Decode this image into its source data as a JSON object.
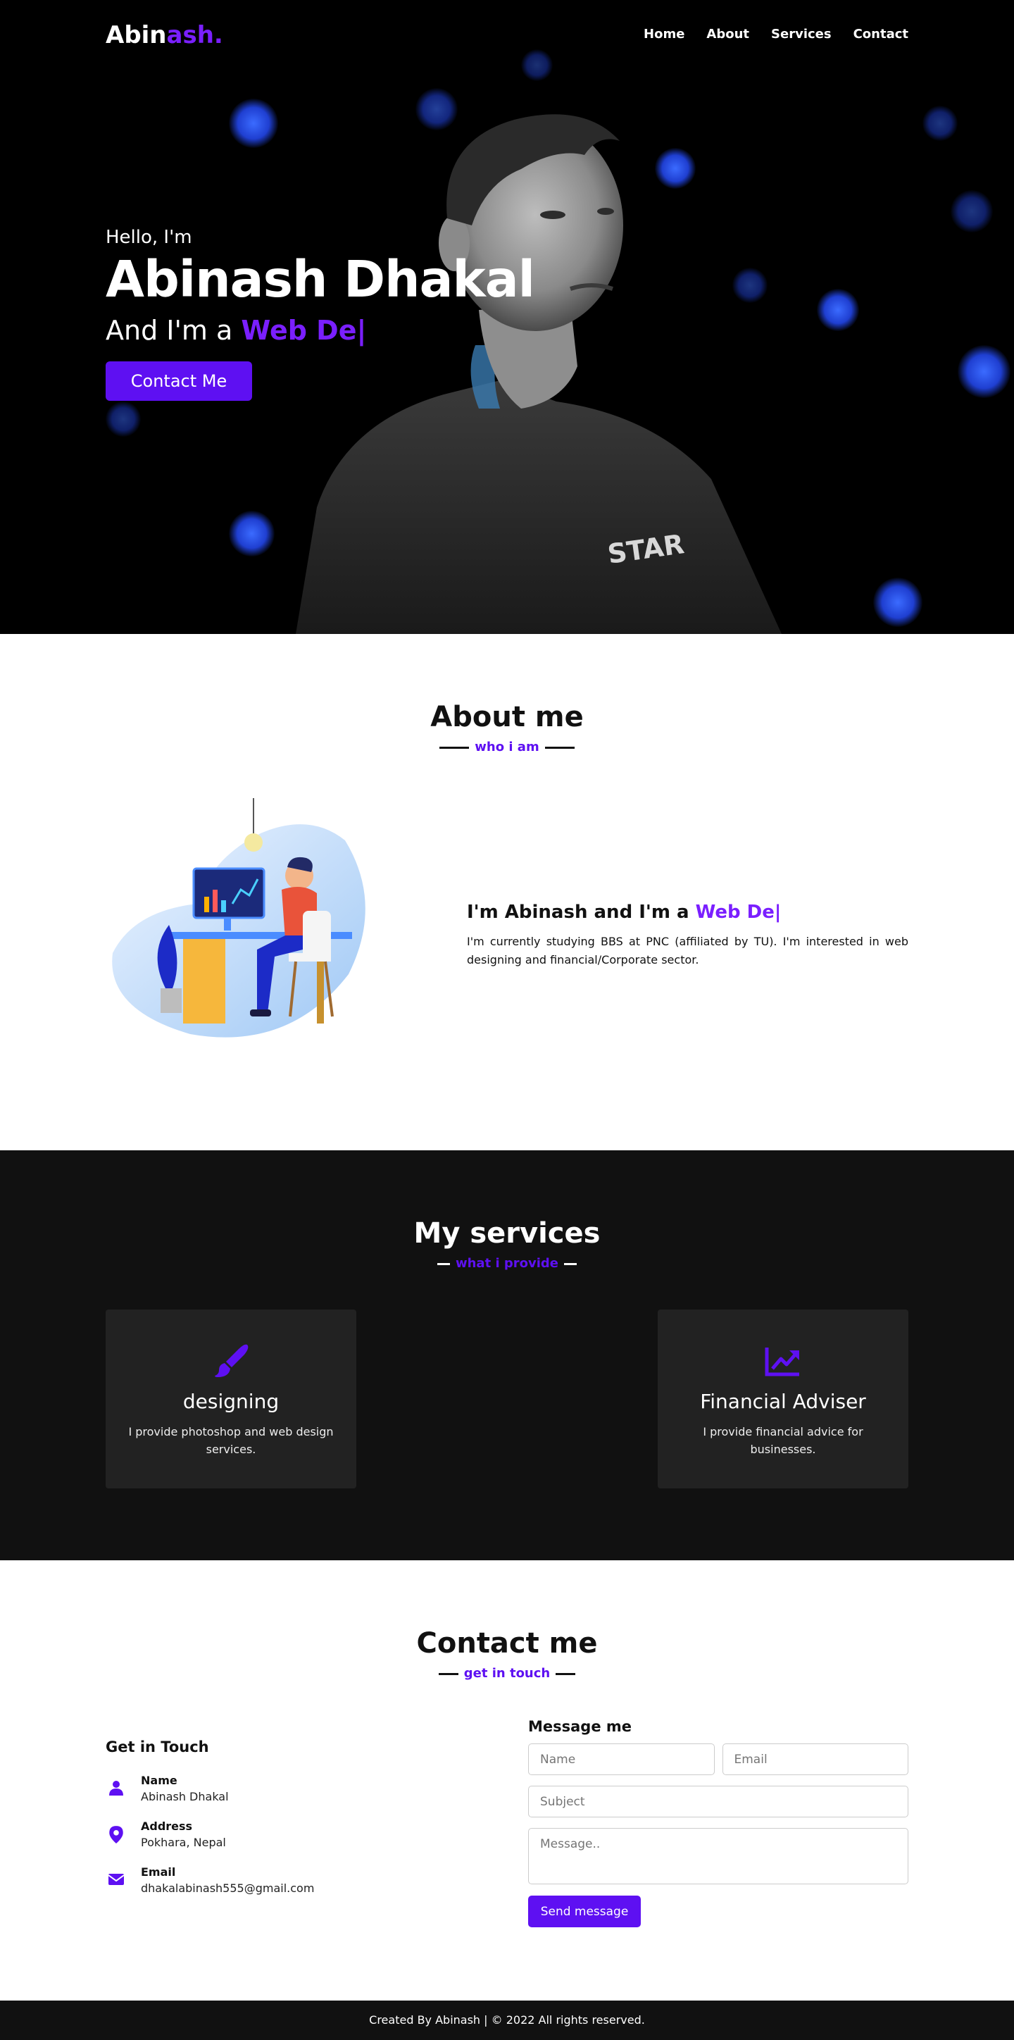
{
  "nav": {
    "logo_main": "Abin",
    "logo_accent": "ash.",
    "items": [
      "Home",
      "About",
      "Services",
      "Contact"
    ]
  },
  "hero": {
    "greeting": "Hello, I'm",
    "name": "Abinash Dhakal",
    "role_prefix": "And I'm a",
    "role_typed": "Web De|",
    "button": "Contact Me"
  },
  "about": {
    "title": "About me",
    "subtitle": "who i am",
    "heading_prefix": "I'm Abinash and I'm a",
    "heading_typed": "Web De|",
    "description": "I'm currently studying BBS at PNC (affiliated by TU). I'm interested in web designing and financial/Corporate sector."
  },
  "services": {
    "title": "My services",
    "subtitle": "what i provide",
    "cards": [
      {
        "icon": "paintbrush-icon",
        "title": "designing",
        "description": "I provide photoshop and web design services."
      },
      {
        "icon": "chart-line-icon",
        "title": "Financial Adviser",
        "description": "I provide financial advice for businesses."
      }
    ]
  },
  "contact": {
    "title": "Contact me",
    "subtitle": "get in touch",
    "left_heading": "Get in Touch",
    "info": [
      {
        "icon": "user-icon",
        "label": "Name",
        "value": "Abinash Dhakal"
      },
      {
        "icon": "map-marker-icon",
        "label": "Address",
        "value": "Pokhara, Nepal"
      },
      {
        "icon": "envelope-icon",
        "label": "Email",
        "value": "dhakalabinash555@gmail.com"
      }
    ],
    "form_heading": "Message me",
    "placeholders": {
      "name": "Name",
      "email": "Email",
      "subject": "Subject",
      "message": "Message.."
    },
    "send_button": "Send message"
  },
  "footer": {
    "text": "Created By Abinash | © 2022 All rights reserved."
  },
  "colors": {
    "accent": "#5e10f2",
    "accent_light": "#7a1fff",
    "dark_bg": "#111111",
    "card_bg": "#222222"
  }
}
